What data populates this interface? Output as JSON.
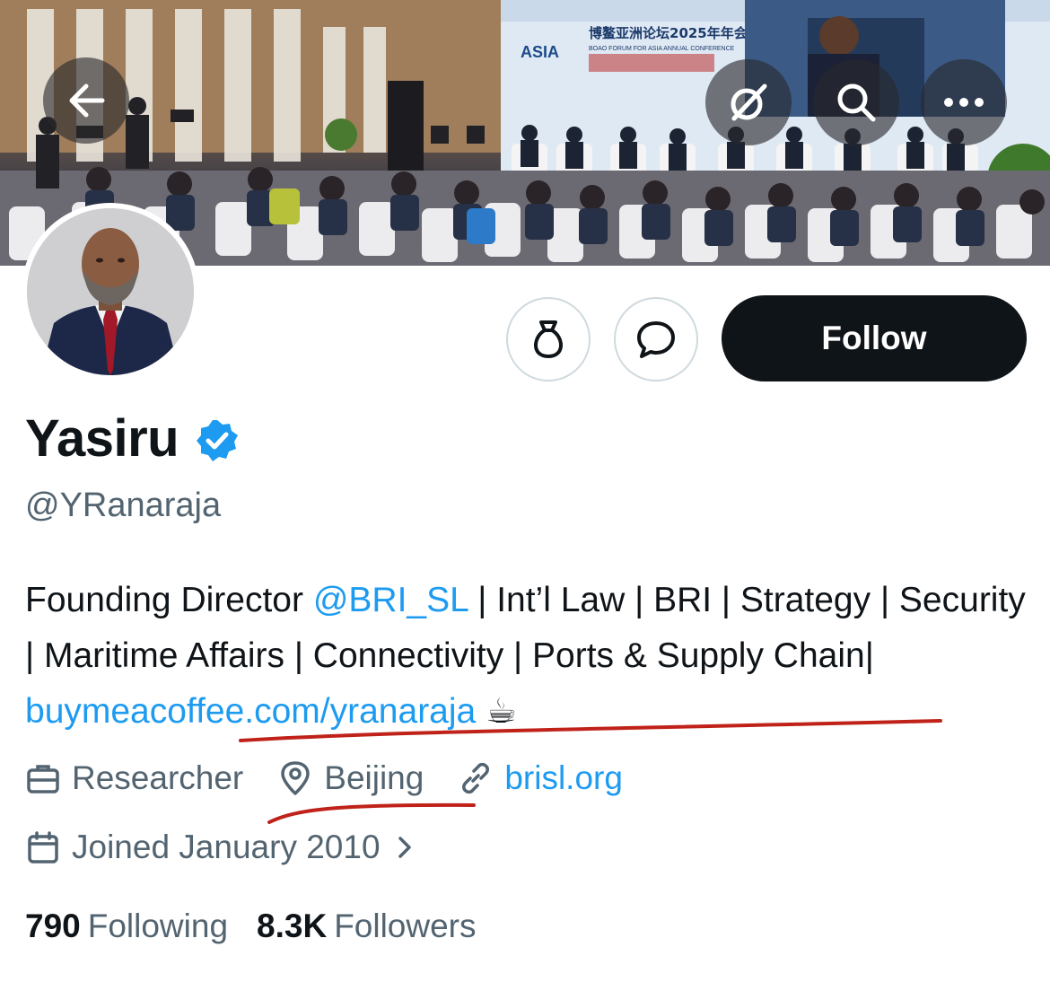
{
  "banner": {
    "event_title_cn": "博鳌亚洲论坛2025年年会",
    "event_title_en": "BOAO FORUM FOR ASIA ANNUAL CONFERENCE",
    "logo_text": "ASIA"
  },
  "top_bar": {
    "back_icon": "arrow-left-icon",
    "grok_icon": "grok-icon",
    "search_icon": "search-icon",
    "more_icon": "more-horizontal-icon"
  },
  "actions": {
    "tip_icon": "money-bag-icon",
    "message_icon": "message-bubble-icon",
    "follow_label": "Follow"
  },
  "profile": {
    "name": "Yasiru",
    "handle": "@YRanaraja",
    "verified": true,
    "bio": {
      "prefix": "Founding Director ",
      "mention": "@BRI_SL",
      "middle": " | Int’l Law | BRI | Strategy | Security | Maritime Affairs | Connectivity | Ports & Supply Chain| ",
      "url": "buymeacoffee.com/yranaraja",
      "emoji": "☕"
    },
    "profession": "Researcher",
    "location": "Beijing",
    "website": "brisl.org",
    "joined": "Joined January 2010"
  },
  "stats": {
    "following_count": "790",
    "following_label": "Following",
    "followers_count": "8.3K",
    "followers_label": "Followers"
  },
  "colors": {
    "link": "#1d9bf0",
    "secondary_text": "#536471",
    "primary_text": "#0f1419",
    "annotation": "#c0221a"
  }
}
